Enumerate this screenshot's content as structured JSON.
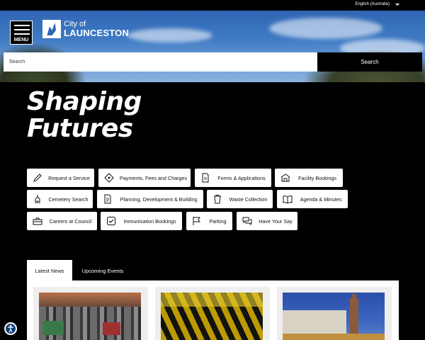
{
  "topbar": {
    "language": "English (Australia)"
  },
  "header": {
    "menu_label": "MENU",
    "logo_line1": "City of",
    "logo_line2": "LAUNCESTON"
  },
  "search": {
    "placeholder": "Search",
    "button_label": "Search"
  },
  "hero": {
    "line1": "Shaping",
    "line2": "Futures"
  },
  "quick_links": [
    {
      "label": "Request a Service",
      "icon": "pencil-icon"
    },
    {
      "label": "Payments, Fees and Charges",
      "icon": "ticket-icon"
    },
    {
      "label": "Forms & Applications",
      "icon": "document-icon"
    },
    {
      "label": "Facility Bookings",
      "icon": "building-icon"
    },
    {
      "label": "Cemetery Search",
      "icon": "church-icon"
    },
    {
      "label": "Planning, Development & Building",
      "icon": "plans-icon"
    },
    {
      "label": "Waste Collection",
      "icon": "bin-icon"
    },
    {
      "label": "Agenda & Minutes",
      "icon": "book-icon"
    },
    {
      "label": "Careers at Council",
      "icon": "briefcase-icon"
    },
    {
      "label": "Immunisation Bookings",
      "icon": "checkbox-icon"
    },
    {
      "label": "Parking",
      "icon": "flag-icon"
    },
    {
      "label": "Have Your Say",
      "icon": "speech-icon"
    }
  ],
  "tabs": [
    {
      "label": "Latest News",
      "active": true
    },
    {
      "label": "Upcoming Events",
      "active": false
    }
  ],
  "colors": {
    "background": "#000000",
    "button_bg": "#ffffff",
    "accessibility": "#0b3e7a"
  }
}
